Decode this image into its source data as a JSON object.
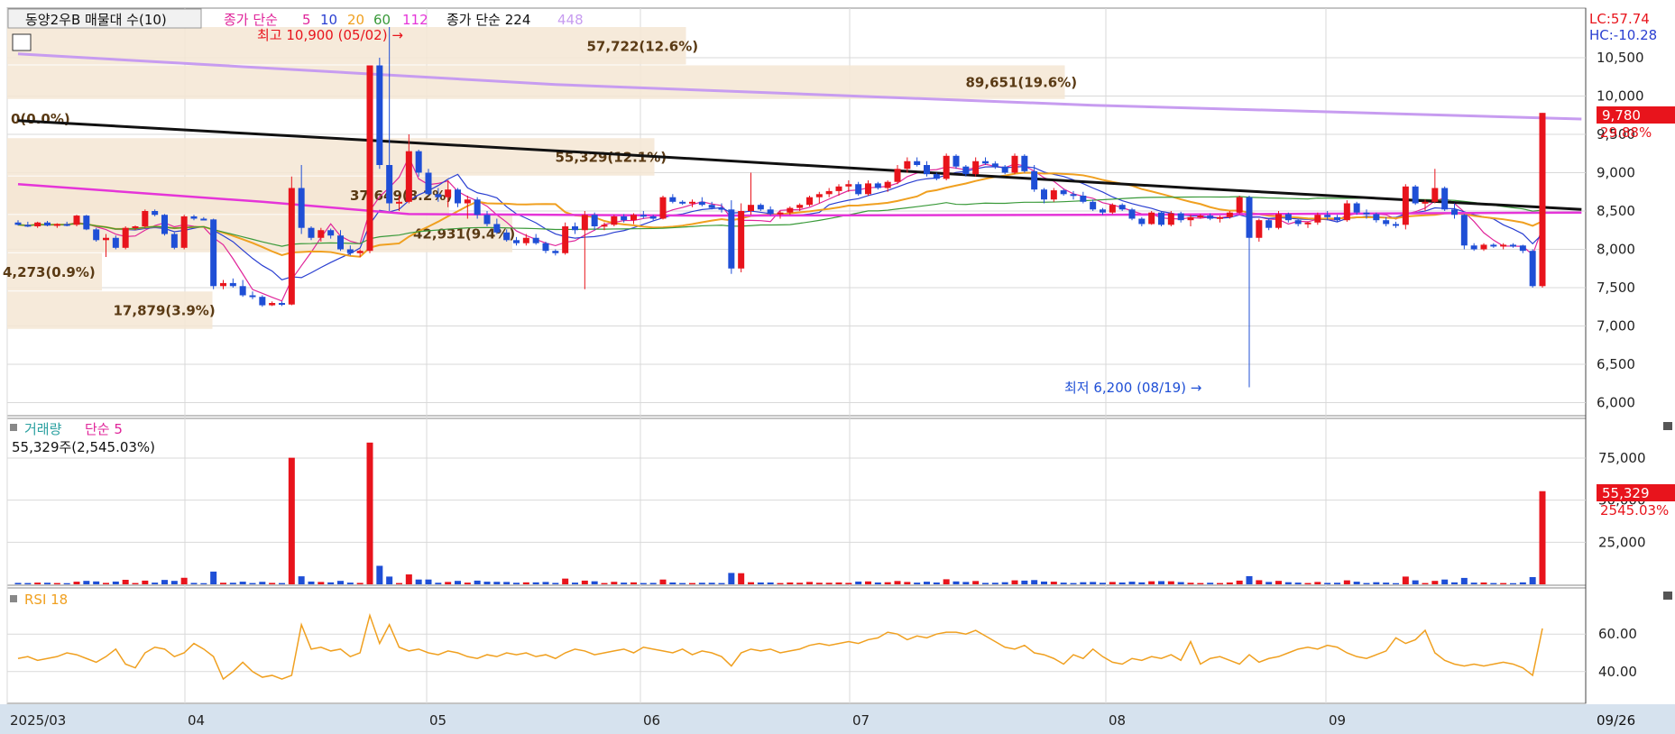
{
  "colors": {
    "up": "#e8141c",
    "down": "#1f4fd6",
    "ma5": "#e0259a",
    "ma10": "#2a3fd1",
    "ma20": "#f0a020",
    "ma60": "#3a9a3a",
    "ma112": "#e535d8",
    "ma224": "#111111",
    "ma448": "#c79cf0",
    "rsi": "#f0a020",
    "profile": "#f5e6d3",
    "badge": "#e8141c"
  },
  "header": {
    "title": "동양2우B 매물대 수(10)",
    "ma_label": "종가 단순",
    "ma_periods": [
      "5",
      "10",
      "20",
      "60",
      "112"
    ],
    "ma_long_label": "종가 단순 224",
    "ma_long2": "448",
    "lc": "LC:57.74",
    "hc": "HC:-10.28"
  },
  "annotations": {
    "high": "최고 10,900 (05/02) →",
    "low": "최저 6,200 (08/19) →",
    "price_badge": "9,780",
    "price_pct": "29.88%",
    "vol_badge": "55,329",
    "vol_pct": "2545.03%"
  },
  "volume_panel": {
    "label": "거래량",
    "ma_label": "단순 5",
    "info": "55,329주(2,545.03%)"
  },
  "rsi_panel": {
    "label": "RSI 18"
  },
  "chart_data": {
    "type": "candlestick",
    "x_range": [
      "2025-03",
      "2025-09-26"
    ],
    "month_ticks": [
      "2025/03",
      "04",
      "05",
      "06",
      "07",
      "08",
      "09"
    ],
    "last_date_label": "09/26",
    "price_axis": {
      "ylim": [
        5900,
        10900
      ],
      "ticks": [
        "10,500",
        "10,000",
        "9,500",
        "9,000",
        "8,500",
        "8,000",
        "7,500",
        "7,000",
        "6,500",
        "6,000"
      ]
    },
    "volume_axis": {
      "ticks": [
        "75,000",
        "50,000",
        "25,000"
      ]
    },
    "rsi_axis": {
      "ticks": [
        "60.00",
        "40.00"
      ]
    },
    "high": {
      "value": 10900,
      "date": "05/02"
    },
    "low": {
      "value": 6200,
      "date": "08/19"
    },
    "last_close": 9780,
    "last_volume": 55329,
    "volume_profile": [
      {
        "label": "57,722(12.6%)",
        "price_low": 10400,
        "price_high": 10900,
        "fraction": 0.43
      },
      {
        "label": "89,651(19.6%)",
        "price_low": 9950,
        "price_high": 10400,
        "fraction": 0.67
      },
      {
        "label": "0(0.0%)",
        "price_low": 9450,
        "price_high": 9950,
        "fraction": 0.0
      },
      {
        "label": "55,329(12.1%)",
        "price_low": 8950,
        "price_high": 9450,
        "fraction": 0.41
      },
      {
        "label": "37,649(8.2%)",
        "price_low": 8450,
        "price_high": 8950,
        "fraction": 0.28
      },
      {
        "label": "37,649(8.2%)",
        "price_low": 8450,
        "price_high": 8950,
        "fraction": 0.28
      },
      {
        "label": "42,931(9.4%)",
        "price_low": 7950,
        "price_high": 8450,
        "fraction": 0.32
      },
      {
        "label": "4,273(0.9%)",
        "price_low": 7450,
        "price_high": 7950,
        "fraction": 0.06
      },
      {
        "label": "17,879(3.9%)",
        "price_low": 6950,
        "price_high": 7450,
        "fraction": 0.13
      }
    ],
    "candles": [
      [
        8350,
        8380,
        8310,
        8320
      ],
      [
        8320,
        8360,
        8290,
        8300
      ],
      [
        8300,
        8360,
        8280,
        8350
      ],
      [
        8350,
        8370,
        8300,
        8310
      ],
      [
        8310,
        8340,
        8280,
        8330
      ],
      [
        8330,
        8360,
        8300,
        8320
      ],
      [
        8320,
        8450,
        8300,
        8440
      ],
      [
        8440,
        8450,
        8250,
        8260
      ],
      [
        8260,
        8280,
        8100,
        8120
      ],
      [
        8120,
        8200,
        7900,
        8150
      ],
      [
        8150,
        8180,
        8000,
        8020
      ],
      [
        8020,
        8300,
        8000,
        8280
      ],
      [
        8280,
        8310,
        8250,
        8300
      ],
      [
        8300,
        8520,
        8280,
        8500
      ],
      [
        8500,
        8520,
        8430,
        8450
      ],
      [
        8450,
        8460,
        8180,
        8200
      ],
      [
        8200,
        8220,
        8000,
        8020
      ],
      [
        8020,
        8450,
        8000,
        8430
      ],
      [
        8430,
        8450,
        8380,
        8400
      ],
      [
        8400,
        8420,
        8380,
        8390
      ],
      [
        8390,
        8400,
        7480,
        7520
      ],
      [
        7520,
        7600,
        7480,
        7560
      ],
      [
        7560,
        7620,
        7500,
        7520
      ],
      [
        7520,
        7600,
        7380,
        7400
      ],
      [
        7400,
        7450,
        7350,
        7380
      ],
      [
        7380,
        7400,
        7250,
        7270
      ],
      [
        7270,
        7320,
        7260,
        7300
      ],
      [
        7300,
        7320,
        7260,
        7280
      ],
      [
        7280,
        8950,
        7270,
        8800
      ],
      [
        8800,
        9100,
        8200,
        8280
      ],
      [
        8280,
        8300,
        8120,
        8150
      ],
      [
        8150,
        8280,
        8100,
        8250
      ],
      [
        8250,
        8270,
        8140,
        8180
      ],
      [
        8180,
        8250,
        7980,
        8000
      ],
      [
        8000,
        8050,
        7920,
        7950
      ],
      [
        7950,
        8000,
        7900,
        7980
      ],
      [
        7980,
        10400,
        7950,
        10400
      ],
      [
        10400,
        10500,
        9050,
        9100
      ],
      [
        9100,
        10900,
        8500,
        8600
      ],
      [
        8600,
        8700,
        8500,
        8620
      ],
      [
        8620,
        9500,
        8600,
        9280
      ],
      [
        9280,
        9300,
        8950,
        9000
      ],
      [
        9000,
        9050,
        8700,
        8720
      ],
      [
        8720,
        8800,
        8620,
        8680
      ],
      [
        8680,
        8900,
        8550,
        8780
      ],
      [
        8780,
        8800,
        8550,
        8600
      ],
      [
        8600,
        8700,
        8400,
        8650
      ],
      [
        8650,
        8680,
        8400,
        8450
      ],
      [
        8450,
        8500,
        8300,
        8330
      ],
      [
        8330,
        8400,
        8200,
        8220
      ],
      [
        8220,
        8260,
        8100,
        8120
      ],
      [
        8120,
        8160,
        8050,
        8080
      ],
      [
        8080,
        8200,
        8050,
        8150
      ],
      [
        8150,
        8200,
        8060,
        8080
      ],
      [
        8080,
        8100,
        7950,
        7980
      ],
      [
        7980,
        8000,
        7920,
        7950
      ],
      [
        7950,
        8350,
        7930,
        8300
      ],
      [
        8300,
        8350,
        8200,
        8250
      ],
      [
        8250,
        8500,
        7480,
        8450
      ],
      [
        8450,
        8480,
        8250,
        8300
      ],
      [
        8300,
        8350,
        8250,
        8320
      ],
      [
        8320,
        8450,
        8300,
        8430
      ],
      [
        8430,
        8460,
        8350,
        8380
      ],
      [
        8380,
        8470,
        8330,
        8450
      ],
      [
        8450,
        8500,
        8400,
        8430
      ],
      [
        8430,
        8450,
        8380,
        8400
      ],
      [
        8400,
        8700,
        8390,
        8680
      ],
      [
        8680,
        8720,
        8600,
        8620
      ],
      [
        8620,
        8640,
        8580,
        8600
      ],
      [
        8600,
        8650,
        8550,
        8620
      ],
      [
        8620,
        8680,
        8560,
        8580
      ],
      [
        8580,
        8620,
        8520,
        8540
      ],
      [
        8540,
        8600,
        8480,
        8520
      ],
      [
        8520,
        8640,
        7680,
        7750
      ],
      [
        7750,
        8600,
        7700,
        8500
      ],
      [
        8500,
        9000,
        8450,
        8580
      ],
      [
        8580,
        8600,
        8500,
        8520
      ],
      [
        8520,
        8560,
        8440,
        8460
      ],
      [
        8460,
        8500,
        8400,
        8480
      ],
      [
        8480,
        8560,
        8450,
        8540
      ],
      [
        8540,
        8600,
        8500,
        8580
      ],
      [
        8580,
        8700,
        8560,
        8680
      ],
      [
        8680,
        8750,
        8600,
        8720
      ],
      [
        8720,
        8800,
        8680,
        8760
      ],
      [
        8760,
        8850,
        8700,
        8820
      ],
      [
        8820,
        8900,
        8750,
        8850
      ],
      [
        8850,
        8880,
        8700,
        8720
      ],
      [
        8720,
        8900,
        8700,
        8860
      ],
      [
        8860,
        8880,
        8780,
        8800
      ],
      [
        8800,
        8900,
        8750,
        8880
      ],
      [
        8880,
        9100,
        8850,
        9050
      ],
      [
        9050,
        9200,
        9000,
        9150
      ],
      [
        9150,
        9200,
        9080,
        9100
      ],
      [
        9100,
        9150,
        8950,
        8980
      ],
      [
        8980,
        9000,
        8900,
        8920
      ],
      [
        8920,
        9250,
        8900,
        9220
      ],
      [
        9220,
        9240,
        9050,
        9080
      ],
      [
        9080,
        9100,
        8950,
        8980
      ],
      [
        8980,
        9200,
        8950,
        9150
      ],
      [
        9150,
        9200,
        9100,
        9120
      ],
      [
        9120,
        9150,
        9050,
        9080
      ],
      [
        9080,
        9100,
        8980,
        9000
      ],
      [
        9000,
        9250,
        8980,
        9220
      ],
      [
        9220,
        9240,
        9000,
        9020
      ],
      [
        9020,
        9100,
        8750,
        8780
      ],
      [
        8780,
        8800,
        8600,
        8650
      ],
      [
        8650,
        8800,
        8620,
        8770
      ],
      [
        8770,
        8790,
        8700,
        8720
      ],
      [
        8720,
        8760,
        8650,
        8700
      ],
      [
        8700,
        8750,
        8600,
        8620
      ],
      [
        8620,
        8650,
        8500,
        8520
      ],
      [
        8520,
        8540,
        8450,
        8480
      ],
      [
        8480,
        8600,
        8460,
        8580
      ],
      [
        8580,
        8600,
        8500,
        8520
      ],
      [
        8520,
        8540,
        8380,
        8400
      ],
      [
        8400,
        8420,
        8300,
        8330
      ],
      [
        8330,
        8500,
        8320,
        8480
      ],
      [
        8480,
        8500,
        8300,
        8320
      ],
      [
        8320,
        8500,
        8300,
        8470
      ],
      [
        8470,
        8490,
        8350,
        8380
      ],
      [
        8380,
        8450,
        8300,
        8420
      ],
      [
        8420,
        8460,
        8400,
        8440
      ],
      [
        8440,
        8470,
        8380,
        8400
      ],
      [
        8400,
        8440,
        8350,
        8420
      ],
      [
        8420,
        8500,
        8400,
        8480
      ],
      [
        8480,
        8700,
        8460,
        8680
      ],
      [
        8680,
        8700,
        6200,
        8150
      ],
      [
        8150,
        8400,
        8100,
        8380
      ],
      [
        8380,
        8400,
        8250,
        8280
      ],
      [
        8280,
        8500,
        8260,
        8460
      ],
      [
        8460,
        8480,
        8350,
        8380
      ],
      [
        8380,
        8400,
        8300,
        8330
      ],
      [
        8330,
        8360,
        8280,
        8350
      ],
      [
        8350,
        8480,
        8320,
        8450
      ],
      [
        8450,
        8500,
        8380,
        8420
      ],
      [
        8420,
        8450,
        8360,
        8380
      ],
      [
        8380,
        8640,
        8360,
        8600
      ],
      [
        8600,
        8620,
        8450,
        8480
      ],
      [
        8480,
        8520,
        8400,
        8460
      ],
      [
        8460,
        8480,
        8350,
        8380
      ],
      [
        8380,
        8420,
        8300,
        8330
      ],
      [
        8330,
        8360,
        8280,
        8320
      ],
      [
        8320,
        8850,
        8260,
        8820
      ],
      [
        8820,
        8840,
        8580,
        8600
      ],
      [
        8600,
        8650,
        8500,
        8620
      ],
      [
        8620,
        9050,
        8600,
        8800
      ],
      [
        8800,
        8820,
        8500,
        8520
      ],
      [
        8520,
        8600,
        8400,
        8450
      ],
      [
        8450,
        8460,
        8000,
        8050
      ],
      [
        8050,
        8080,
        7980,
        8000
      ],
      [
        8000,
        8080,
        7980,
        8060
      ],
      [
        8060,
        8080,
        8020,
        8040
      ],
      [
        8040,
        8080,
        8000,
        8060
      ],
      [
        8060,
        8080,
        8020,
        8050
      ],
      [
        8050,
        8060,
        7950,
        7980
      ],
      [
        7980,
        8000,
        7500,
        7520
      ],
      [
        7520,
        9780,
        7500,
        9780
      ]
    ],
    "ma": {
      "ma224": [
        [
          0,
          9680
        ],
        [
          60,
          9250
        ],
        [
          120,
          8800
        ],
        [
          160,
          8520
        ]
      ],
      "ma448": [
        [
          0,
          10550
        ],
        [
          55,
          10150
        ],
        [
          110,
          9880
        ],
        [
          160,
          9700
        ]
      ],
      "ma112": [
        [
          0,
          8850
        ],
        [
          25,
          8620
        ],
        [
          40,
          8460
        ],
        [
          70,
          8440
        ],
        [
          110,
          8450
        ],
        [
          160,
          8480
        ]
      ]
    },
    "rsi": [
      47,
      48,
      46,
      47,
      48,
      50,
      49,
      47,
      45,
      48,
      52,
      44,
      42,
      50,
      53,
      52,
      48,
      50,
      55,
      52,
      48,
      36,
      40,
      45,
      40,
      37,
      38,
      36,
      38,
      65,
      52,
      53,
      51,
      52,
      48,
      50,
      70,
      55,
      65,
      53,
      51,
      52,
      50,
      49,
      51,
      50,
      48,
      47,
      49,
      48,
      50,
      49,
      50,
      48,
      49,
      47,
      50,
      52,
      51,
      49,
      50,
      51,
      52,
      50,
      53,
      52,
      51,
      50,
      52,
      49,
      51,
      50,
      48,
      43,
      50,
      52,
      51,
      52,
      50,
      51,
      52,
      54,
      55,
      54,
      55,
      56,
      55,
      57,
      58,
      61,
      60,
      57,
      59,
      58,
      60,
      61,
      61,
      60,
      62,
      59,
      56,
      53,
      52,
      54,
      50,
      49,
      47,
      44,
      49,
      47,
      52,
      48,
      45,
      44,
      47,
      46,
      48,
      47,
      49,
      46,
      56,
      44,
      47,
      48,
      46,
      44,
      49,
      45,
      47,
      48,
      50,
      52,
      53,
      52,
      54,
      53,
      50,
      48,
      47,
      49,
      51,
      58,
      55,
      57,
      62,
      50,
      46,
      44,
      43,
      44,
      43,
      44,
      45,
      44,
      42,
      38,
      63
    ]
  }
}
